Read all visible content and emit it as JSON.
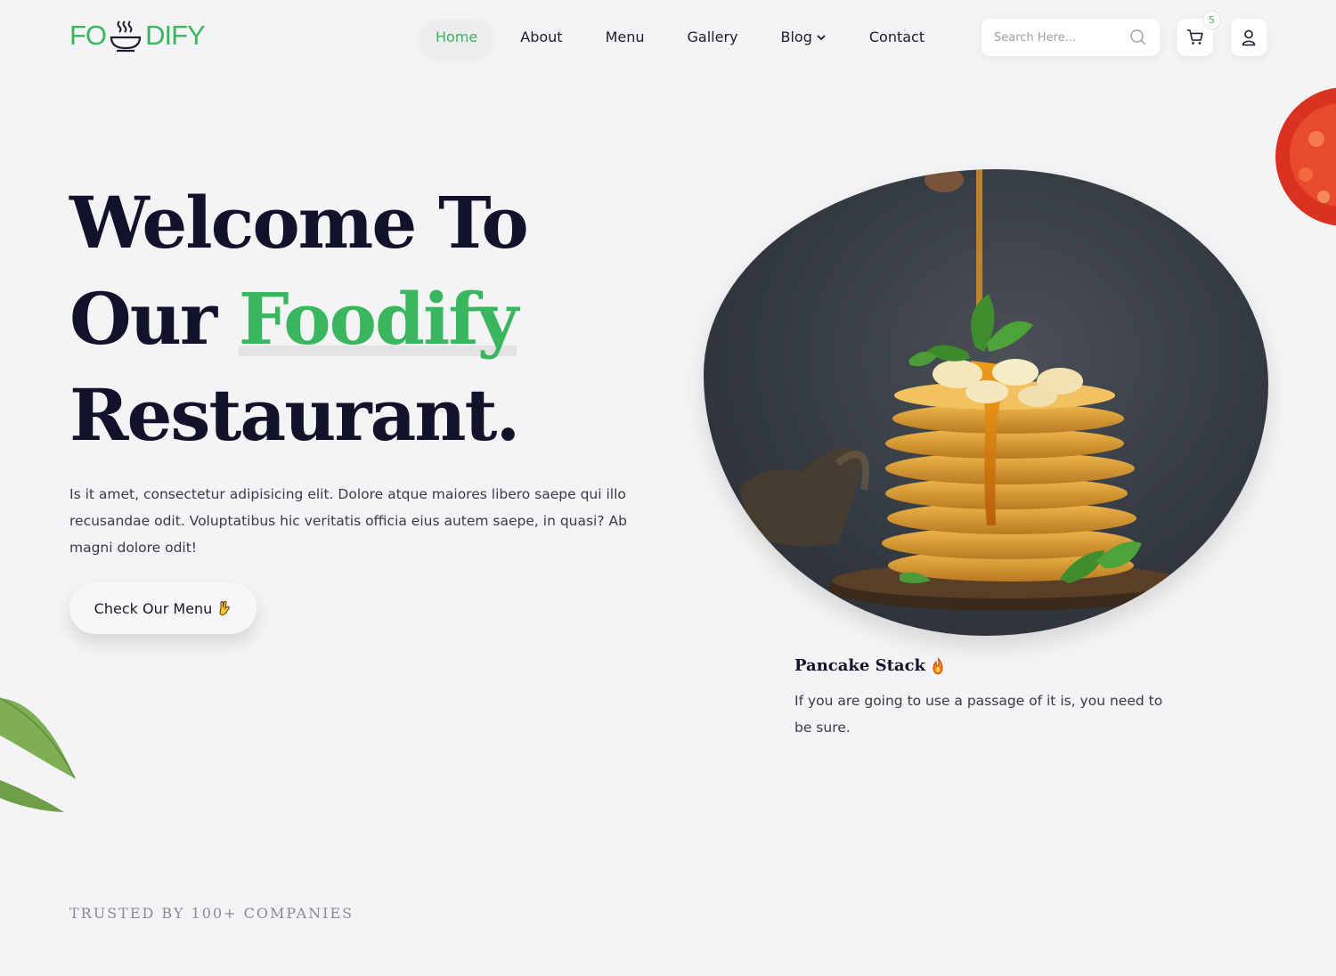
{
  "logo": {
    "left_text": "FO",
    "right_text": "DIFY"
  },
  "nav": {
    "items": [
      {
        "label": "Home"
      },
      {
        "label": "About"
      },
      {
        "label": "Menu"
      },
      {
        "label": "Gallery"
      },
      {
        "label": "Blog"
      },
      {
        "label": "Contact"
      }
    ]
  },
  "search": {
    "placeholder": "Search Here..."
  },
  "cart": {
    "count": "5"
  },
  "hero": {
    "line1": "Welcome To",
    "line2_prefix": "Our ",
    "line2_highlight": "Foodify",
    "line3": "Restaurant.",
    "description": "Is it amet, consectetur adipisicing elit. Dolore atque maiores libero saepe qui illo recusandae odit. Voluptatibus hic veritatis officia eius autem saepe, in quasi? Ab magni dolore odit!",
    "cta_label": "Check Our Menu"
  },
  "dish": {
    "title": "Pancake Stack",
    "description": "If you are going to use a passage of it is, you need to be sure."
  },
  "trusted": {
    "label": "TRUSTED BY 100+ COMPANIES"
  },
  "colors": {
    "accent": "#3ab65f",
    "heading": "#12122a",
    "background": "#f4f4f6"
  },
  "icons": [
    "bowl-icon",
    "chevron-down-icon",
    "search-icon",
    "cart-icon",
    "user-icon",
    "hand-icon",
    "fire-icon"
  ]
}
